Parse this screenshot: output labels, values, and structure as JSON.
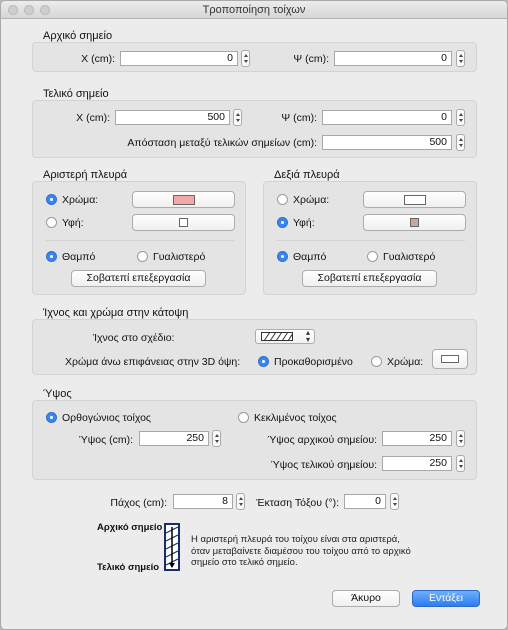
{
  "window": {
    "title": "Τροποποίηση τοίχων"
  },
  "colors": {
    "accent": "#3a86f0",
    "left_color_swatch": "#f0a8a8",
    "right_texture_swatch": "#c8a898"
  },
  "start_point": {
    "header": "Αρχικό σημείο",
    "x_label": "X (cm):",
    "x_value": "0",
    "y_label": "Ψ (cm):",
    "y_value": "0"
  },
  "end_point": {
    "header": "Τελικό σημείο",
    "x_label": "X (cm):",
    "x_value": "500",
    "y_label": "Ψ (cm):",
    "y_value": "0",
    "distance_label": "Απόσταση μεταξύ τελικών σημείων (cm):",
    "distance_value": "500"
  },
  "left_side": {
    "header": "Αριστερή πλευρά",
    "color_label": "Χρώμα:",
    "texture_label": "Υφή:",
    "matt_label": "Θαμπό",
    "glossy_label": "Γυαλιστερό",
    "modify_button": "Σοβατεπί επεξεργασία"
  },
  "right_side": {
    "header": "Δεξιά πλευρά",
    "color_label": "Χρώμα:",
    "texture_label": "Υφή:",
    "matt_label": "Θαμπό",
    "glossy_label": "Γυαλιστερό",
    "modify_button": "Σοβατεπί επεξεργασία"
  },
  "pattern": {
    "header": "Ίχνος και χρώμα στην κάτοψη",
    "plan_pattern_label": "Ίχνος στο σχέδιο:",
    "top_color_label": "Χρώμα άνω επιφάνειας στην 3D όψη:",
    "default_label": "Προκαθορισμένο",
    "color_label": "Χρώμα:"
  },
  "height": {
    "header": "Ύψος",
    "rectangular_label": "Ορθογώνιος τοίχος",
    "sloping_label": "Κεκλιμένος τοίχος",
    "height_label": "Ύψος (cm):",
    "height_value": "250",
    "start_height_label": "Ύψος αρχικού σημείου:",
    "start_height_value": "250",
    "end_height_label": "Ύψος τελικού σημείου:",
    "end_height_value": "250"
  },
  "bottom": {
    "thickness_label": "Πάχος (cm):",
    "thickness_value": "8",
    "arc_label": "Έκταση Τόξου (°):",
    "arc_value": "0"
  },
  "legend": {
    "start_label": "Αρχικό σημείο",
    "end_label": "Τελικό σημείο",
    "info_line1": "Η αριστερή πλευρά του τοίχου είναι στα αριστερά,",
    "info_line2": "όταν μεταβαίνετε διαμέσου του τοίχου από το αρχικό",
    "info_line3": "σημείο στο τελικό σημείο."
  },
  "buttons": {
    "cancel": "Άκυρο",
    "ok": "Εντάξει"
  }
}
